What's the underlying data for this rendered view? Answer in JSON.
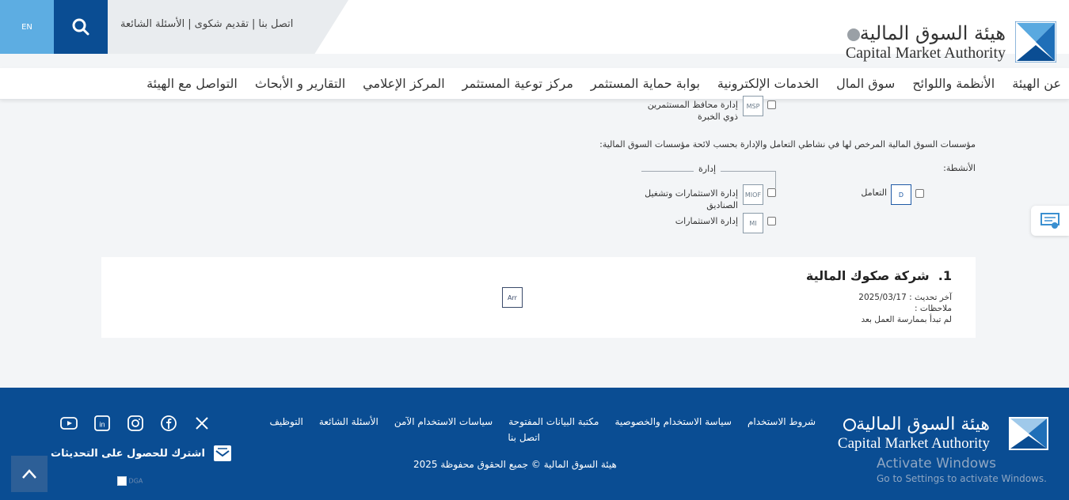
{
  "header": {
    "lang_label": "EN",
    "top_links": [
      "اتصل بنا",
      "تقديم شكوى",
      "الأسئلة الشائعة"
    ],
    "logo_ar": "هيئة السوق المالية",
    "logo_en": "Capital Market Authority",
    "nav": [
      "عن الهيئة",
      "الأنظمة واللوائح",
      "سوق المال",
      "الخدمات الإلكترونية",
      "بوابة حماية المستثمر",
      "مركز توعية المستثمر",
      "المركز الإعلامي",
      "التقارير و الأبحاث",
      "التواصل مع الهيئة"
    ]
  },
  "content": {
    "msp_label_1": "إدارة محافظ المستثمرين",
    "msp_label_2": "ذوي الخبرة",
    "msp_code": "MSP",
    "licensed_text": "مؤسسات السوق المالية المرخص لها في نشاطي التعامل والإدارة بحسب لائحة مؤسسات السوق المالية:",
    "activities_label": "الأنشطة:",
    "management_group": "إدارة",
    "dealing_label": "التعامل",
    "dealing_code": "D",
    "miof_label_1": "إدارة الاستثمارات وتشغيل",
    "miof_label_2": "الصناديق",
    "miof_code": "MIOF",
    "mi_label": "إدارة الاستثمارات",
    "mi_code": "MI"
  },
  "card": {
    "number": "1.",
    "title": "شركة صكوك المالية",
    "updated_label": "آخر تحديث :",
    "updated_date": "2025/03/17",
    "notes_label": "ملاحظات :",
    "notes_value": "لم تبدأ بممارسة العمل بعد",
    "code": "Arr"
  },
  "footer": {
    "logo_ar": "هيئة السوق المالية",
    "logo_en": "Capital Market Authority",
    "links": [
      "شروط الاستخدام",
      "سياسة الاستخدام والخصوصية",
      "مكتبة البيانات المفتوحة",
      "سياسات الاستخدام الآمن",
      "الأسئلة الشائعة",
      "التوظيف",
      "اتصل بنا"
    ],
    "copyright": "هيئة السوق المالية © جميع الحقوق محفوظة 2025",
    "subscribe": "اشترك للحصول على التحديثات",
    "socials": [
      "x-icon",
      "facebook-icon",
      "instagram-icon",
      "linkedin-icon",
      "youtube-icon"
    ],
    "broken_image_alt": "DGA"
  },
  "os": {
    "activate_title": "Activate Windows",
    "activate_sub": "Go to Settings to activate Windows."
  },
  "colors": {
    "primary": "#0a4d93",
    "lang_button": "#5dade2",
    "footer_bg": "#0a4d93"
  }
}
